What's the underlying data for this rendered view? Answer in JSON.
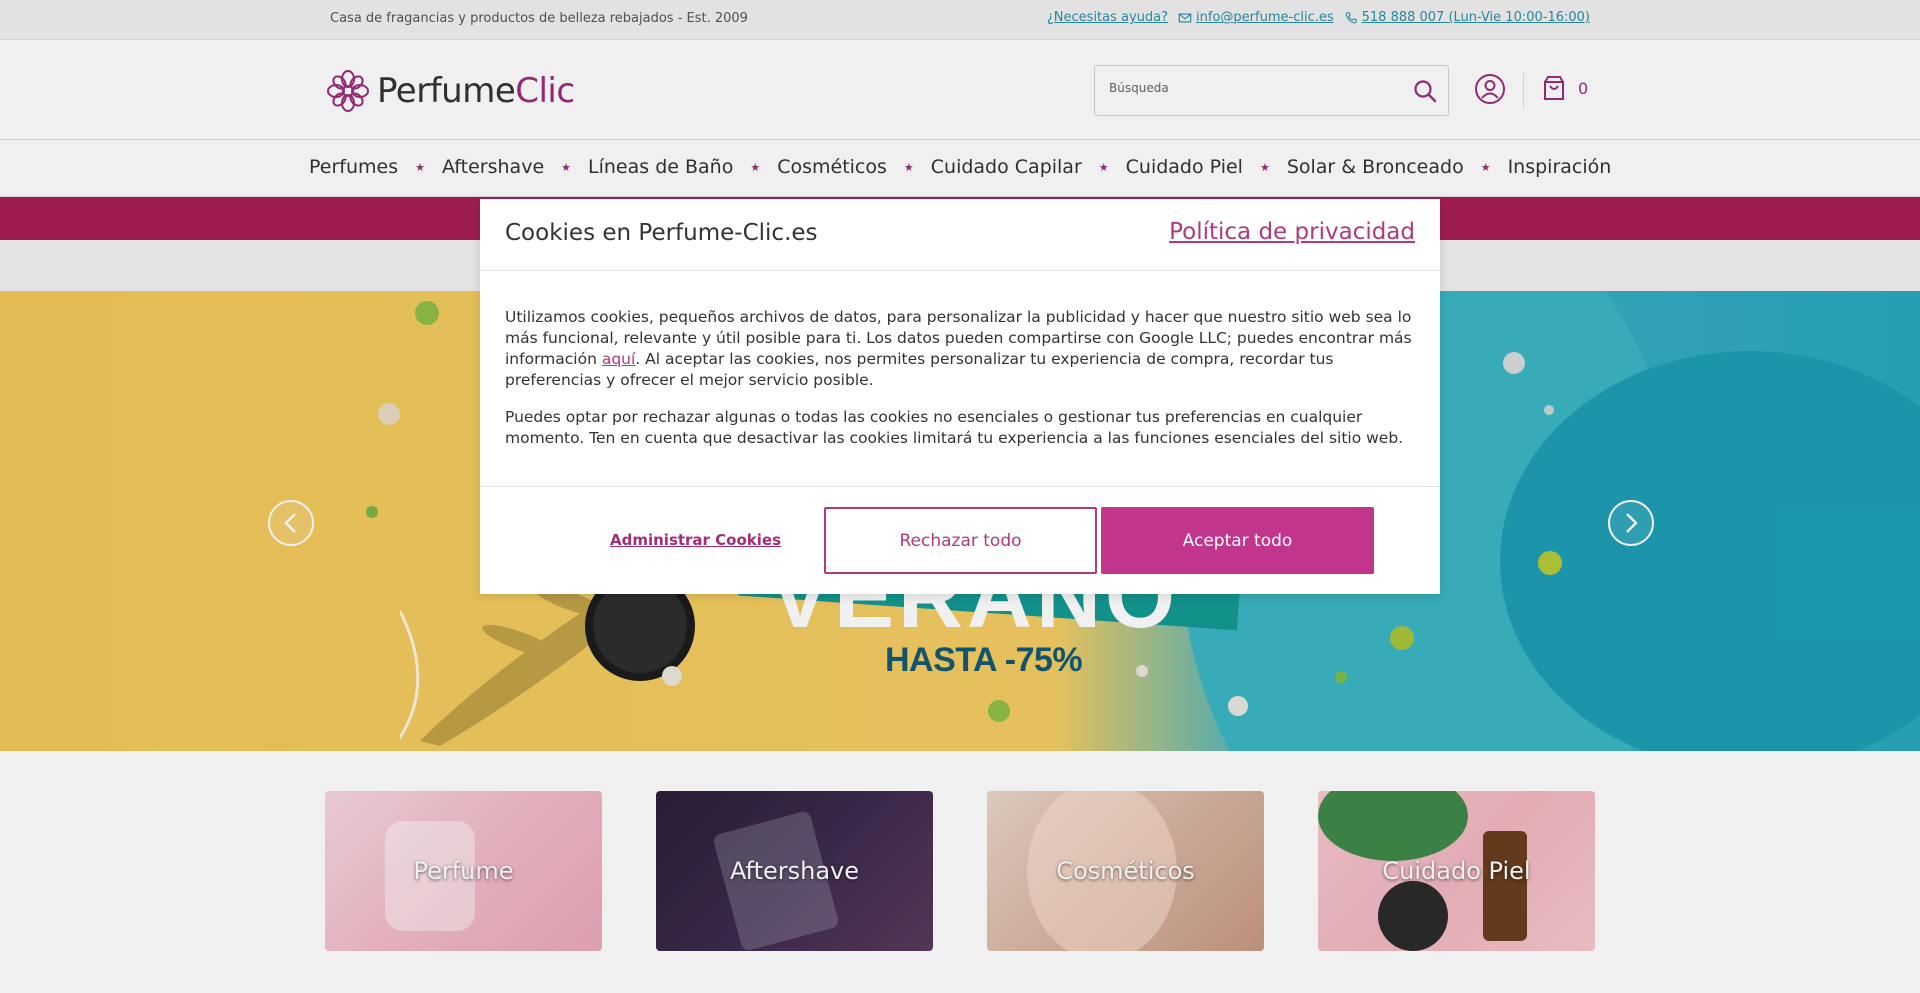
{
  "topbar": {
    "tagline": "Casa de fragancias y productos de belleza rebajados - Est. 2009",
    "help": "¿Necesitas ayuda?",
    "email": "info@perfume-clic.es",
    "phone": "518 888 007 (Lun-Vie 10:00-16:00)"
  },
  "header": {
    "logo_part1": "Perfume",
    "logo_part2": "Clic",
    "search_placeholder": "Búsqueda",
    "cart_count": "0"
  },
  "nav": {
    "items": [
      "Perfumes",
      "Aftershave",
      "Líneas de Baño",
      "Cosméticos",
      "Cuidado Capilar",
      "Cuidado Piel",
      "Solar & Bronceado",
      "Inspiración"
    ]
  },
  "hero": {
    "headline": "VERANO",
    "subtext": "HASTA -75%"
  },
  "tiles": [
    "Perfume",
    "Aftershave",
    "Cosméticos",
    "Cuidado Piel"
  ],
  "cookie_modal": {
    "title": "Cookies en Perfume-Clic.es",
    "privacy_link": "Política de privacidad",
    "p1_before": "Utilizamos cookies, pequeños archivos de datos, para personalizar la publicidad y hacer que nuestro sitio web sea lo más funcional, relevante y útil posible para ti. Los datos pueden compartirse con Google LLC; puedes encontrar más información ",
    "p1_link": "aquí",
    "p1_after": ". Al aceptar las cookies, nos permites personalizar tu experiencia de compra, recordar tus preferencias y ofrecer el mejor servicio posible.",
    "p2": "Puedes optar por rechazar algunas o todas las cookies no esenciales o gestionar tus preferencias en cualquier momento. Ten en cuenta que desactivar las cookies limitará tu experiencia a las funciones esenciales del sitio web.",
    "manage_label": "Administrar Cookies",
    "reject_label": "Rechazar todo",
    "accept_label": "Aceptar todo"
  },
  "colors": {
    "brand": "#9b2c7c",
    "accept_button": "#c2358d",
    "promo_strip": "#a81e56",
    "link_teal": "#2a8fa8"
  },
  "icons": {
    "email": "mail-icon",
    "phone": "phone-icon",
    "search": "search-icon",
    "user": "user-icon",
    "cart": "cart-icon",
    "prev": "chevron-left-icon",
    "next": "chevron-right-icon"
  }
}
